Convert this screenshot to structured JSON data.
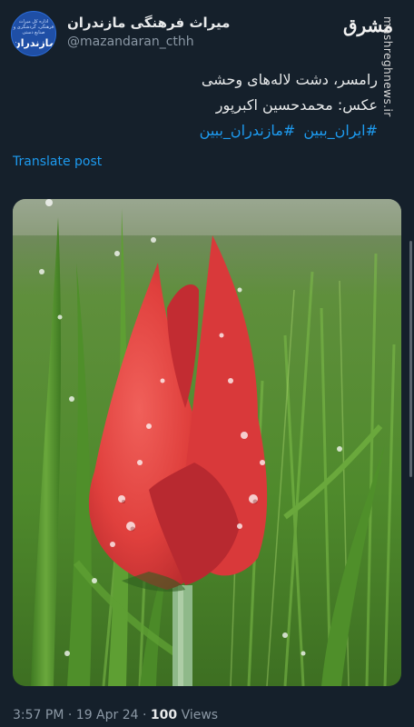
{
  "account": {
    "display_name": "میراث فرهنگی مازندران",
    "handle": "@mazandaran_cthh",
    "avatar_small_text": "اداره کل میراث فرهنگی، گردشگری و صنایع دستی",
    "avatar_big_text": "مازندران"
  },
  "watermark": {
    "logo_text": "مشرق",
    "site_text": "mashreghnews.ir"
  },
  "tweet": {
    "line1": "رامسر، دشت لاله‌های وحشی",
    "line2": "عکس: محمدحسین اکبرپور",
    "hashtags": [
      "#ایران_ببین",
      "#مازندران_ببین"
    ],
    "translate_label": "Translate post"
  },
  "photo": {
    "subject": "red-tulip-with-water-drops"
  },
  "meta": {
    "time": "3:57 PM",
    "date": "19 Apr 24",
    "separator": "·",
    "views_count": "100",
    "views_label": "Views"
  },
  "colors": {
    "background": "#15202b",
    "link": "#1d9bf0",
    "muted": "#8b98a5",
    "tulip": "#e8413f"
  }
}
